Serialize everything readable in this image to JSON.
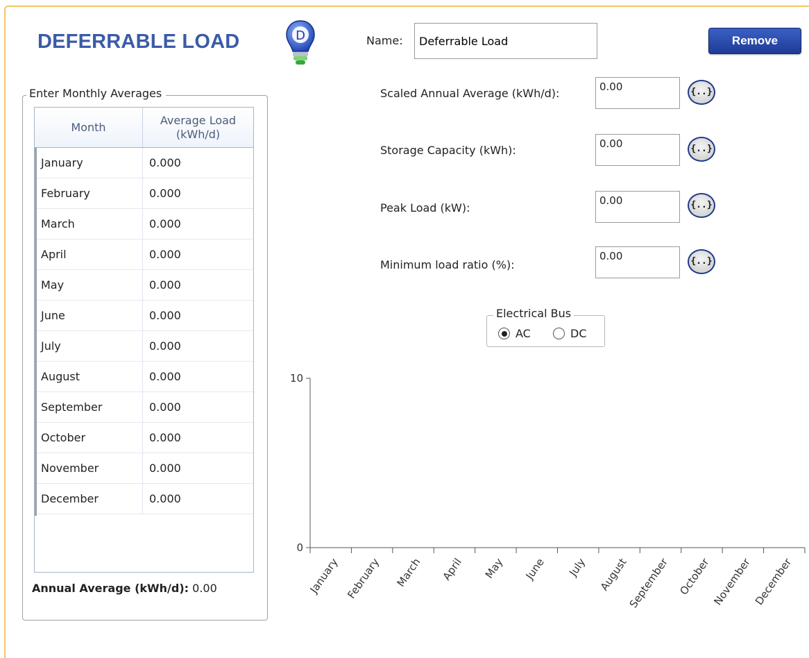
{
  "header": {
    "title": "DEFERRABLE LOAD",
    "icon_letter": "D",
    "name_label": "Name:",
    "name_value": "Deferrable Load",
    "remove_label": "Remove"
  },
  "monthly": {
    "legend": "Enter Monthly Averages",
    "col_month": "Month",
    "col_load": "Average Load (kWh/d)",
    "rows": [
      {
        "month": "January",
        "value": "0.000"
      },
      {
        "month": "February",
        "value": "0.000"
      },
      {
        "month": "March",
        "value": "0.000"
      },
      {
        "month": "April",
        "value": "0.000"
      },
      {
        "month": "May",
        "value": "0.000"
      },
      {
        "month": "June",
        "value": "0.000"
      },
      {
        "month": "July",
        "value": "0.000"
      },
      {
        "month": "August",
        "value": "0.000"
      },
      {
        "month": "September",
        "value": "0.000"
      },
      {
        "month": "October",
        "value": "0.000"
      },
      {
        "month": "November",
        "value": "0.000"
      },
      {
        "month": "December",
        "value": "0.000"
      }
    ],
    "annual_label": "Annual Average (kWh/d):",
    "annual_value": "0.00"
  },
  "fields": [
    {
      "label": "Scaled Annual Average (kWh/d):",
      "value": "0.00",
      "button": "{..}"
    },
    {
      "label": "Storage Capacity (kWh):",
      "value": "0.00",
      "button": "{..}"
    },
    {
      "label": "Peak Load (kW):",
      "value": "0.00",
      "button": "{..}"
    },
    {
      "label": "Minimum load ratio (%):",
      "value": "0.00",
      "button": "{..}"
    }
  ],
  "bus": {
    "legend": "Electrical Bus",
    "options": [
      "AC",
      "DC"
    ],
    "selected": "AC"
  },
  "chart_data": {
    "type": "bar",
    "categories": [
      "January",
      "February",
      "March",
      "April",
      "May",
      "June",
      "July",
      "August",
      "September",
      "October",
      "November",
      "December"
    ],
    "values": [
      0,
      0,
      0,
      0,
      0,
      0,
      0,
      0,
      0,
      0,
      0,
      0
    ],
    "ylim": [
      0,
      10
    ],
    "yticks": [
      "0",
      "10"
    ],
    "grid": false
  },
  "colors": {
    "title": "#3b5ba8",
    "accent_border": "#f0c66a",
    "button_blue": "#2a4cb0"
  }
}
